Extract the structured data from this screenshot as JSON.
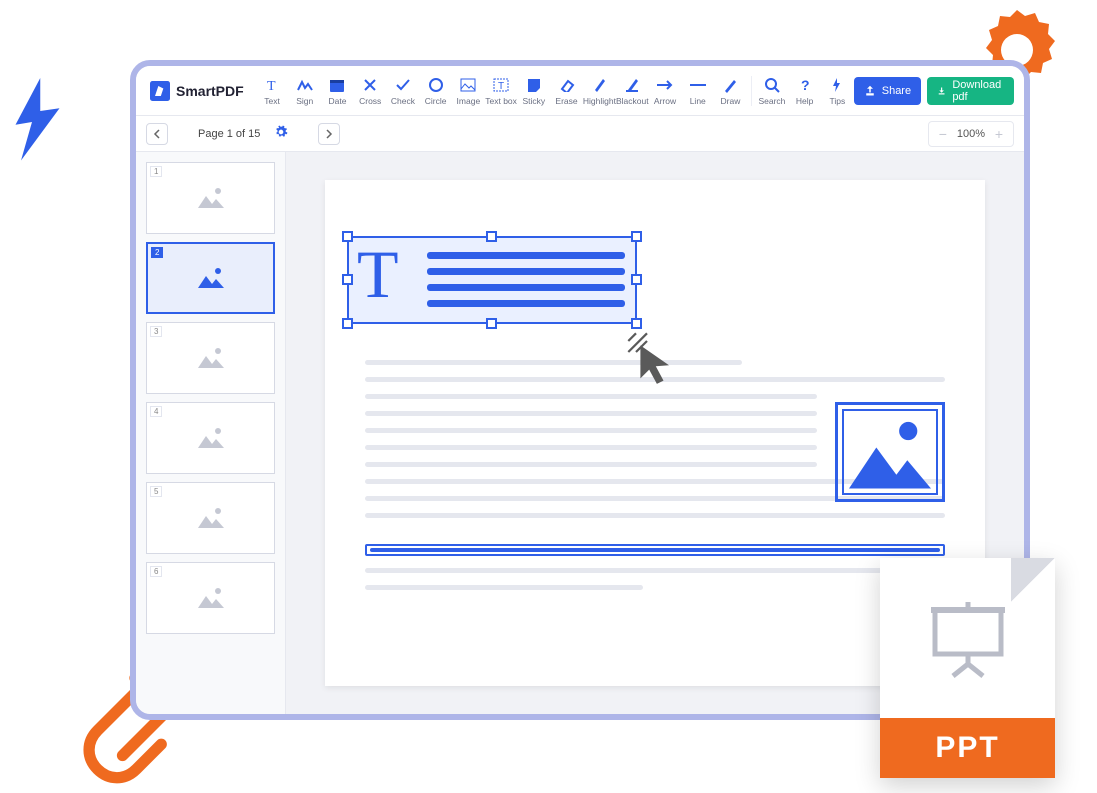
{
  "brand": "SmartPDF",
  "toolbar": {
    "tools": [
      {
        "id": "text",
        "label": "Text"
      },
      {
        "id": "sign",
        "label": "Sign"
      },
      {
        "id": "date",
        "label": "Date"
      },
      {
        "id": "cross",
        "label": "Cross"
      },
      {
        "id": "check",
        "label": "Check"
      },
      {
        "id": "circle",
        "label": "Circle"
      },
      {
        "id": "image",
        "label": "Image"
      },
      {
        "id": "textbox",
        "label": "Text box"
      },
      {
        "id": "sticky",
        "label": "Sticky"
      },
      {
        "id": "erase",
        "label": "Erase"
      },
      {
        "id": "highlight",
        "label": "Highlight"
      },
      {
        "id": "blackout",
        "label": "Blackout"
      },
      {
        "id": "arrow",
        "label": "Arrow"
      },
      {
        "id": "line",
        "label": "Line"
      },
      {
        "id": "draw",
        "label": "Draw"
      }
    ],
    "util": [
      {
        "id": "search",
        "label": "Search"
      },
      {
        "id": "help",
        "label": "Help"
      },
      {
        "id": "tips",
        "label": "Tips"
      }
    ],
    "share_label": "Share",
    "download_label": "Download pdf"
  },
  "navigation": {
    "page_label": "Page 1 of 15",
    "zoom": "100%"
  },
  "thumbnails": [
    {
      "page": "1",
      "active": false
    },
    {
      "page": "2",
      "active": true
    },
    {
      "page": "3",
      "active": false
    },
    {
      "page": "4",
      "active": false
    },
    {
      "page": "5",
      "active": false
    },
    {
      "page": "6",
      "active": false
    }
  ],
  "file_badge": {
    "type": "PPT"
  },
  "colors": {
    "accent": "#2f5fe8",
    "green": "#16b583",
    "orange": "#ef6a1f",
    "window_border": "#aeb5e8"
  }
}
